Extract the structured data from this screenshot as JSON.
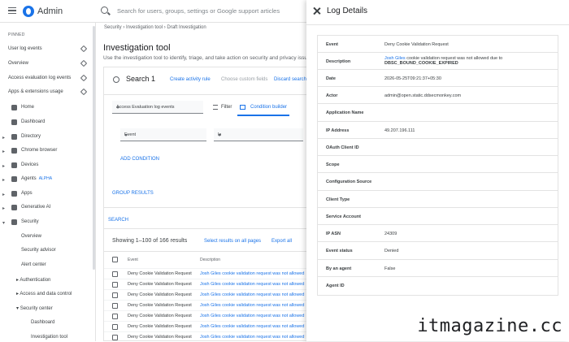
{
  "app": {
    "brand": "Admin",
    "search_placeholder": "Search for users, groups, settings or Google support articles"
  },
  "sidebar": {
    "pinned_label": "PINNED",
    "pinned": [
      "User log events",
      "Overview",
      "Access evaluation log events",
      "Apps & extensions usage"
    ],
    "nav": [
      {
        "label": "Home",
        "caret": ""
      },
      {
        "label": "Dashboard",
        "caret": ""
      },
      {
        "label": "Directory",
        "caret": "▸"
      },
      {
        "label": "Chrome browser",
        "caret": "▸"
      },
      {
        "label": "Devices",
        "caret": "▸"
      },
      {
        "label": "Agents",
        "caret": "▸",
        "badge": "ALPHA"
      },
      {
        "label": "Apps",
        "caret": "▸"
      },
      {
        "label": "Generative AI",
        "caret": "▸"
      },
      {
        "label": "Security",
        "caret": "▾"
      }
    ],
    "security_sub": [
      "Overview",
      "Security advisor",
      "Alert center",
      "Authentication",
      "Access and data control",
      "Security center"
    ],
    "security_center_sub": [
      "Dashboard",
      "Investigation tool"
    ]
  },
  "main": {
    "breadcrumb": "Security  ›  Investigation tool  ›  Draft Investigation",
    "title": "Investigation tool",
    "description": "Use the investigation tool to identify, triage, and take action on security and privacy issues",
    "search_title": "Search 1",
    "create_activity_rule": "Create activity rule",
    "choose_custom_fields": "Choose custom fields",
    "discard_search": "Discard search",
    "data_source": "Access Evaluation log events",
    "filter_label": "Filter",
    "condition_builder_label": "Condition builder",
    "attribute_field": "Event",
    "operator_field": "Is",
    "add_condition": "ADD CONDITION",
    "group_results": "GROUP RESULTS",
    "search_button": "SEARCH",
    "showing": "Showing 1–100 of 166 results",
    "select_all": "Select results on all pages",
    "export_all": "Export all",
    "columns": [
      "Event",
      "Description"
    ],
    "rows": [
      {
        "event": "Deny Cookie Validation Request",
        "desc": "Josh Giles cookie validation request was not allowed"
      },
      {
        "event": "Deny Cookie Validation Request",
        "desc": "Josh Giles cookie validation request was not allowed"
      },
      {
        "event": "Deny Cookie Validation Request",
        "desc": "Josh Giles cookie validation request was not allowed"
      },
      {
        "event": "Deny Cookie Validation Request",
        "desc": "Josh Giles cookie validation request was not allowed"
      },
      {
        "event": "Deny Cookie Validation Request",
        "desc": "Josh Giles cookie validation request was not allowed"
      },
      {
        "event": "Deny Cookie Validation Request",
        "desc": "Josh Giles cookie validation request was not allowed"
      },
      {
        "event": "Deny Cookie Validation Request",
        "desc": "Josh Giles cookie validation request was not allowed"
      },
      {
        "event": "Deny Cookie Validation Request",
        "desc": "Josh Giles cookie validation request was not allowed"
      }
    ]
  },
  "panel": {
    "title": "Log Details",
    "fields": [
      {
        "label": "Event",
        "value": "Deny Cookie Validation Request"
      },
      {
        "label": "Description",
        "value_link": "Josh Giles",
        "value": " cookie validation request was not allowed due to",
        "value_line2": "DBSC_BOUND_COOKIE_EXPIRED"
      },
      {
        "label": "Date",
        "value": "2026-05-25T09:21:37+05:30"
      },
      {
        "label": "Actor",
        "value": "admin@open.static.ddsecmonkey.com"
      },
      {
        "label": "Application Name",
        "value": ""
      },
      {
        "label": "IP Address",
        "value": "49.207.196.111"
      },
      {
        "label": "OAuth Client ID",
        "value": ""
      },
      {
        "label": "Scope",
        "value": ""
      },
      {
        "label": "Configuration Source",
        "value": ""
      },
      {
        "label": "Client Type",
        "value": ""
      },
      {
        "label": "Service Account",
        "value": ""
      },
      {
        "label": "IP ASN",
        "value": "24309"
      },
      {
        "label": "Event status",
        "value": "Denied"
      },
      {
        "label": "By an agent",
        "value": "False"
      },
      {
        "label": "Agent ID",
        "value": ""
      }
    ]
  },
  "watermark": "itmagazine.cc"
}
